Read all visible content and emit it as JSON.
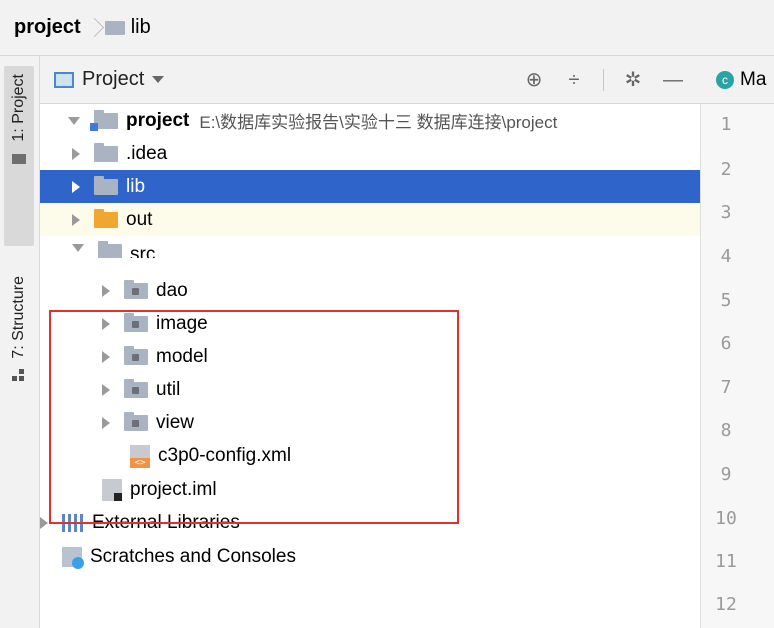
{
  "breadcrumb": {
    "project": "project",
    "folder": "lib"
  },
  "side_tabs": {
    "project": "1: Project",
    "structure": "7: Structure"
  },
  "panel": {
    "title": "Project",
    "tools": {
      "locate_icon": "⊕",
      "collapse_icon": "÷",
      "settings_icon": "✲",
      "hide_icon": "—"
    }
  },
  "tree": [
    {
      "name": "project",
      "path": "E:\\数据库实验报告\\实验十三  数据库连接\\project",
      "icon": "module-folder",
      "state": "expanded"
    },
    {
      "name": ".idea",
      "icon": "folder",
      "state": "collapsed"
    },
    {
      "name": "lib",
      "icon": "folder",
      "state": "collapsed",
      "selected": true
    },
    {
      "name": "out",
      "icon": "orange-folder",
      "state": "collapsed"
    },
    {
      "name": "src",
      "icon": "folder",
      "state": "expanded"
    },
    {
      "name": "dao",
      "icon": "package-folder",
      "state": "collapsed"
    },
    {
      "name": "image",
      "icon": "package-folder",
      "state": "collapsed"
    },
    {
      "name": "model",
      "icon": "package-folder",
      "state": "collapsed"
    },
    {
      "name": "util",
      "icon": "package-folder",
      "state": "collapsed"
    },
    {
      "name": "view",
      "icon": "package-folder",
      "state": "collapsed"
    },
    {
      "name": "c3p0-config.xml",
      "icon": "xml-file",
      "state": "leaf"
    },
    {
      "name": "project.iml",
      "icon": "iml-file",
      "state": "leaf"
    },
    {
      "name": "External Libraries",
      "icon": "library",
      "state": "collapsed"
    },
    {
      "name": "Scratches and Consoles",
      "icon": "scratch",
      "state": "leaf"
    }
  ],
  "editor": {
    "tab_label": "Ma",
    "tab_icon": "c",
    "line_numbers": [
      "1",
      "2",
      "3",
      "4",
      "5",
      "6",
      "7",
      "8",
      "9",
      "10",
      "11",
      "12"
    ]
  },
  "colors": {
    "selection": "#2f65ca",
    "highlight_row": "#fdfcea",
    "annotation_box": "#e03030"
  }
}
